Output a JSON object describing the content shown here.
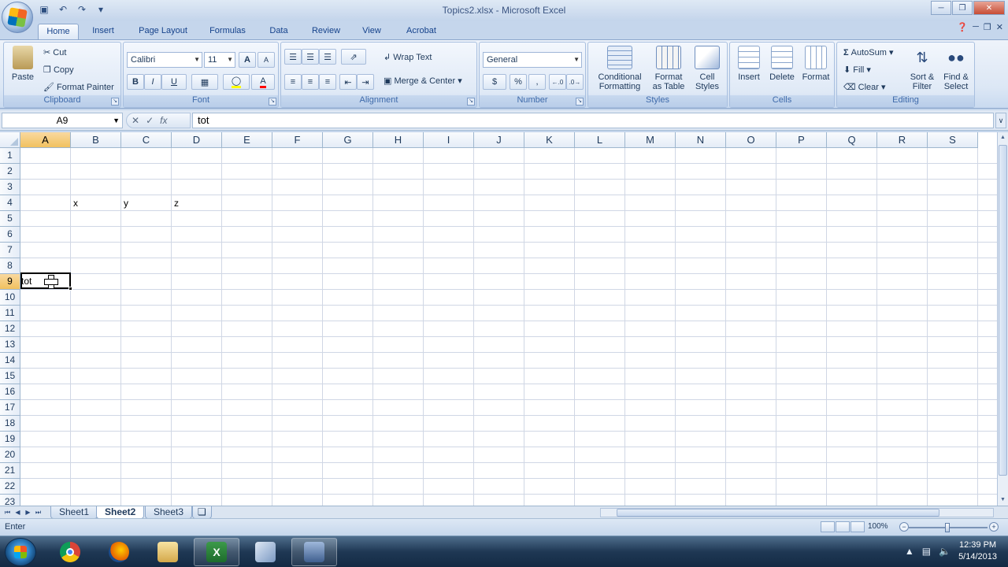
{
  "window": {
    "title": "Topics2.xlsx - Microsoft Excel"
  },
  "ribbon_tabs": [
    "Home",
    "Insert",
    "Page Layout",
    "Formulas",
    "Data",
    "Review",
    "View",
    "Acrobat"
  ],
  "clipboard": {
    "paste": "Paste",
    "cut": "Cut",
    "copy": "Copy",
    "format_painter": "Format Painter",
    "label": "Clipboard"
  },
  "font": {
    "name": "Calibri",
    "size": "11",
    "bold": "B",
    "italic": "I",
    "underline": "U",
    "grow": "A",
    "shrink": "A",
    "color_letter": "A",
    "label": "Font"
  },
  "alignment": {
    "wrap_text": "Wrap Text",
    "merge_center": "Merge & Center",
    "label": "Alignment"
  },
  "number": {
    "format": "General",
    "currency": "$",
    "percent": "%",
    "comma": ",",
    "label": "Number"
  },
  "styles": {
    "conditional_1": "Conditional",
    "conditional_2": "Formatting",
    "format_table_1": "Format",
    "format_table_2": "as Table",
    "cell_styles_1": "Cell",
    "cell_styles_2": "Styles",
    "label": "Styles"
  },
  "cells": {
    "insert": "Insert",
    "delete": "Delete",
    "format": "Format",
    "label": "Cells"
  },
  "editing": {
    "autosum": "AutoSum",
    "fill": "Fill",
    "clear": "Clear",
    "sort_1": "Sort &",
    "sort_2": "Filter",
    "find_1": "Find &",
    "find_2": "Select",
    "label": "Editing"
  },
  "formula_bar": {
    "name_box": "A9",
    "content": "tot",
    "fx": "fx"
  },
  "columns": [
    "A",
    "B",
    "C",
    "D",
    "E",
    "F",
    "G",
    "H",
    "I",
    "J",
    "K",
    "L",
    "M",
    "N",
    "O",
    "P",
    "Q",
    "R",
    "S"
  ],
  "rows": [
    "1",
    "2",
    "3",
    "4",
    "5",
    "6",
    "7",
    "8",
    "9",
    "10",
    "11",
    "12",
    "13",
    "14",
    "15",
    "16",
    "17",
    "18",
    "19",
    "20",
    "21",
    "22",
    "23"
  ],
  "cells_data": {
    "B4": "x",
    "C4": "y",
    "D4": "z",
    "A9": "tot"
  },
  "active_cell": "A9",
  "sheets": [
    "Sheet1",
    "Sheet2",
    "Sheet3"
  ],
  "active_sheet": "Sheet2",
  "status": {
    "mode": "Enter",
    "zoom": "100%"
  },
  "taskbar": {
    "time": "12:39 PM",
    "date": "5/14/2013"
  },
  "icons": [
    "office-button-icon",
    "save-icon",
    "undo-icon",
    "redo-icon",
    "help-icon",
    "start-icon",
    "chrome-icon",
    "firefox-icon",
    "explorer-icon",
    "excel-icon",
    "notepad-icon",
    "video-icon"
  ]
}
